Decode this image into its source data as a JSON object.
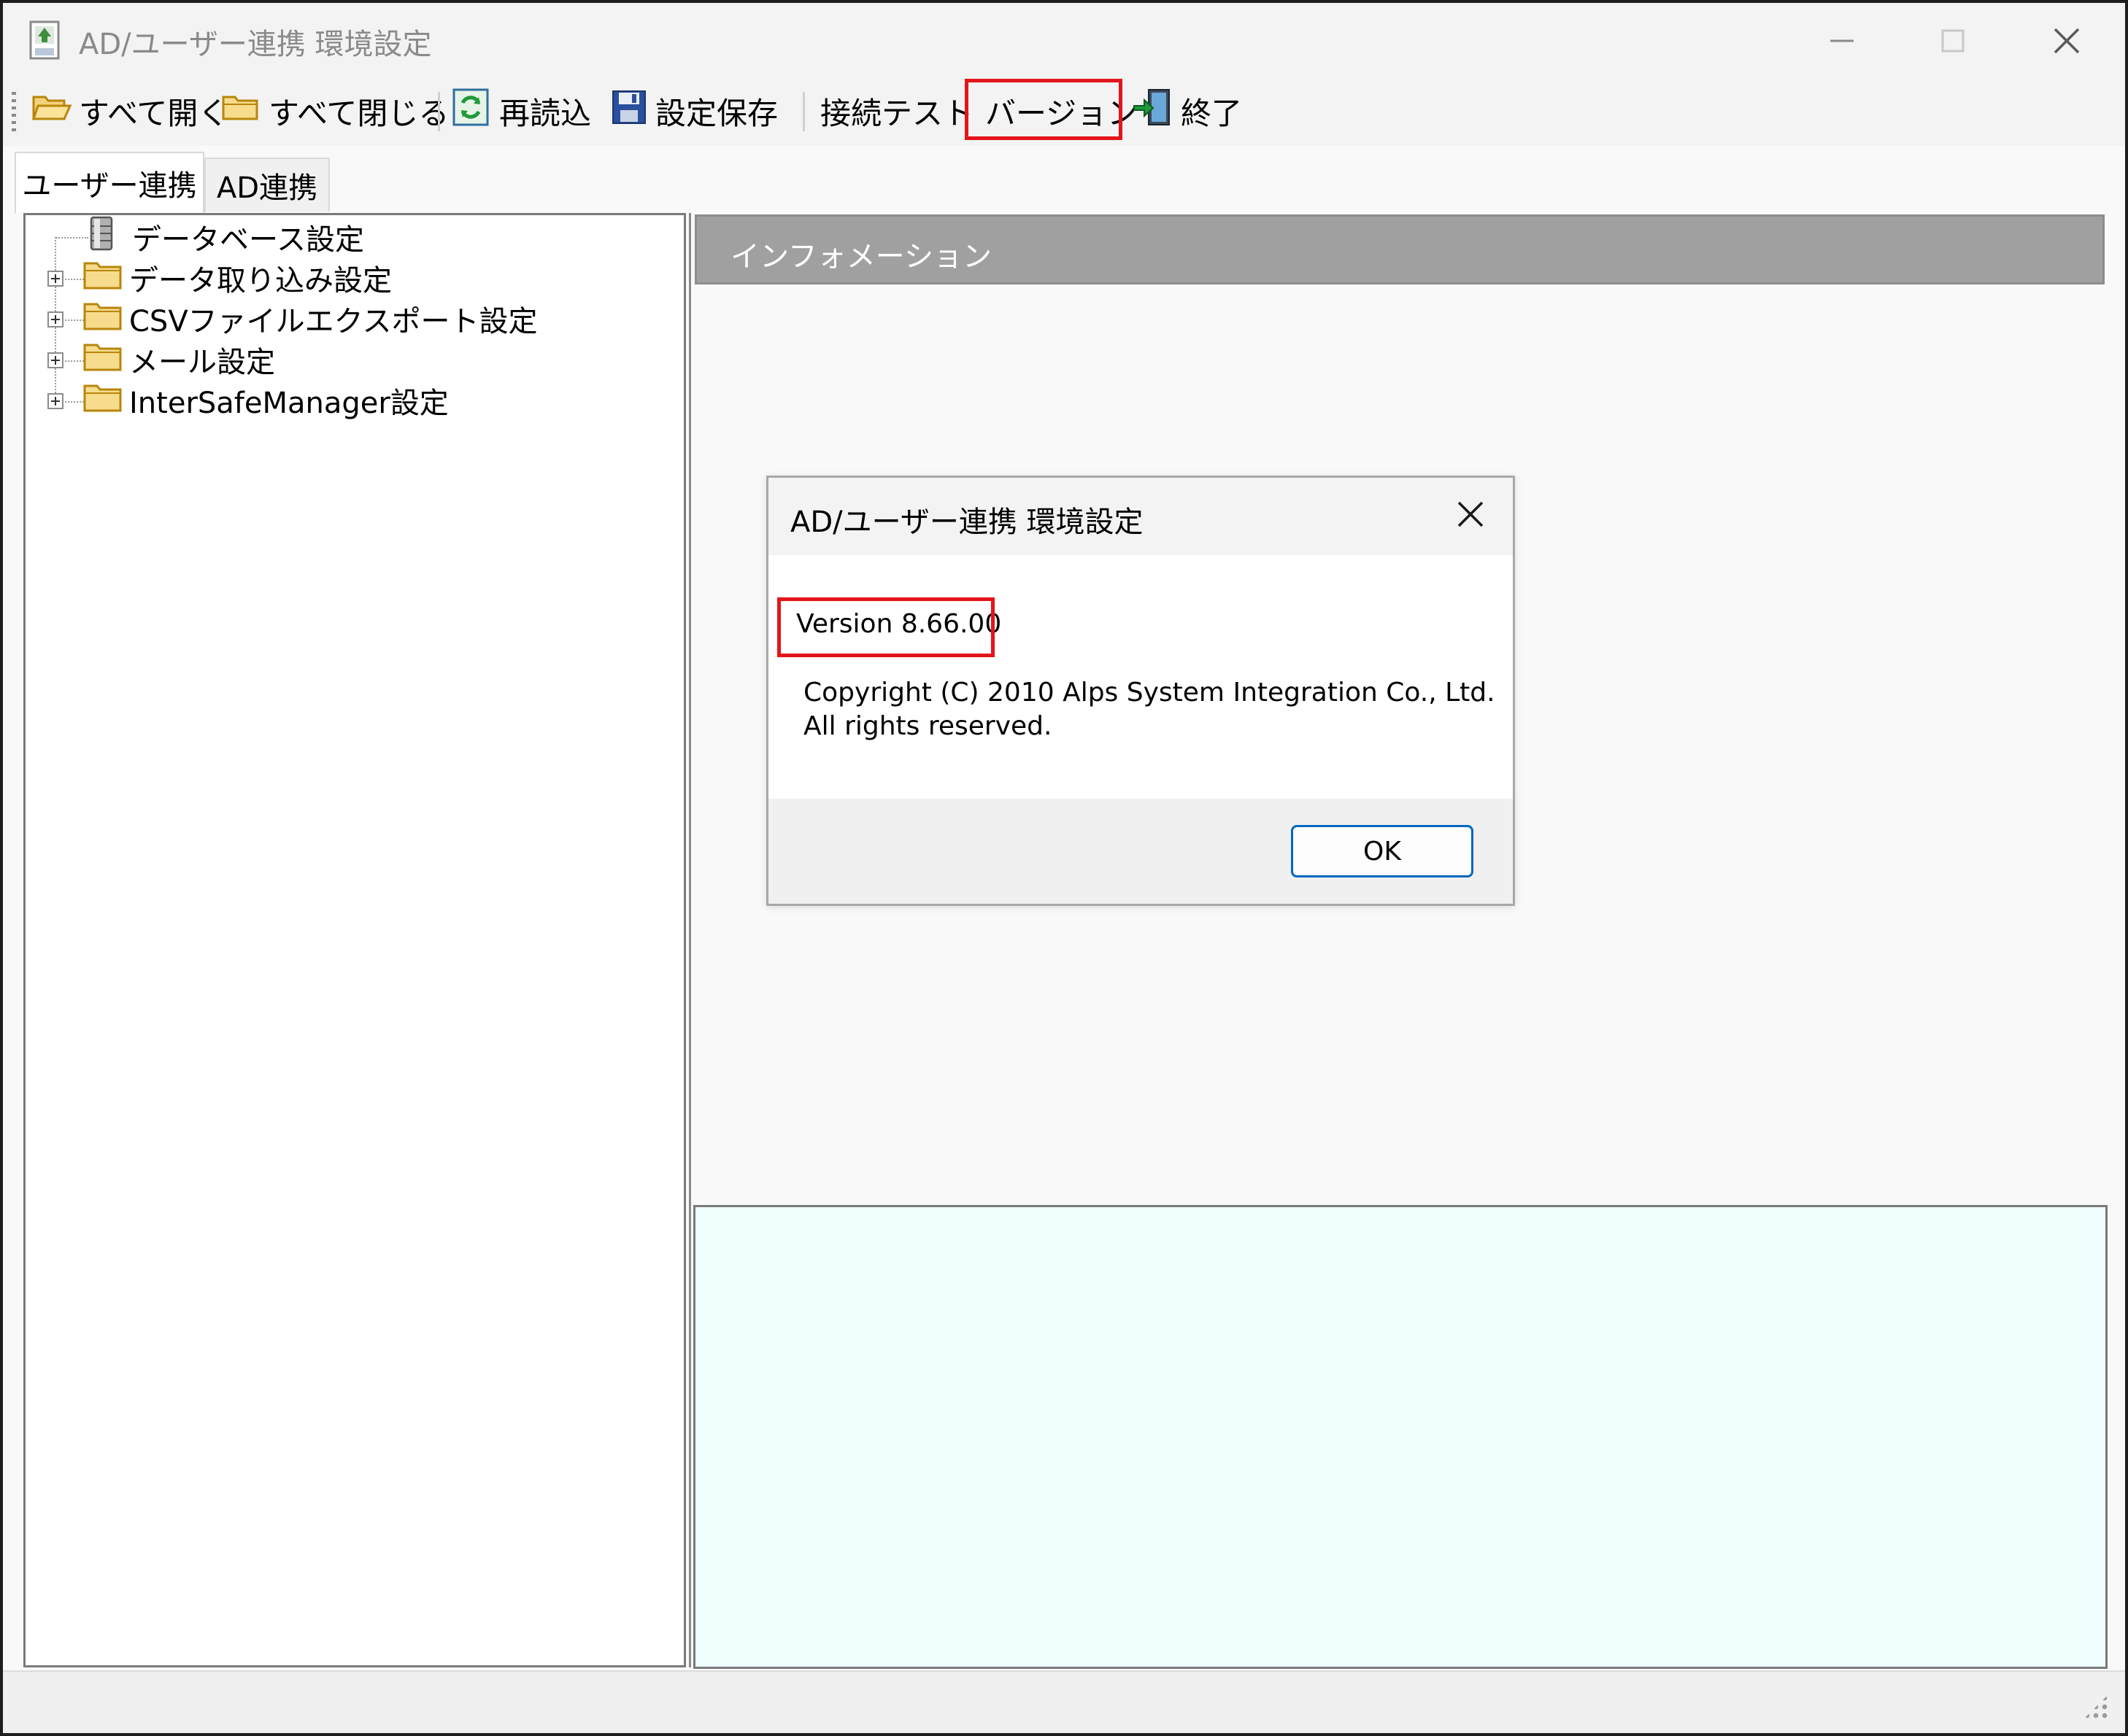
{
  "window": {
    "title": "AD/ユーザー連携 環境設定"
  },
  "toolbar": {
    "expand_all": "すべて開く",
    "collapse_all": "すべて閉じる",
    "reload": "再読込",
    "save_settings": "設定保存",
    "connection_test": "接続テスト",
    "version": "バージョン",
    "exit": "終了"
  },
  "tabs": [
    {
      "label": "ユーザー連携",
      "selected": true
    },
    {
      "label": "AD連携",
      "selected": false
    }
  ],
  "tree": {
    "items": [
      {
        "label": "データベース設定",
        "icon": "database-icon",
        "expandable": false
      },
      {
        "label": "データ取り込み設定",
        "icon": "folder-icon",
        "expandable": true
      },
      {
        "label": "CSVファイルエクスポート設定",
        "icon": "folder-icon",
        "expandable": true
      },
      {
        "label": "メール設定",
        "icon": "folder-icon",
        "expandable": true
      },
      {
        "label": "InterSafeManager設定",
        "icon": "folder-icon",
        "expandable": true
      }
    ]
  },
  "info_panel": {
    "header": "インフォメーション"
  },
  "dialog": {
    "title": "AD/ユーザー連携 環境設定",
    "version": "Version 8.66.00",
    "copyright_line1": "Copyright (C) 2010 Alps System Integration Co., Ltd.",
    "copyright_line2": "All rights reserved.",
    "ok_label": "OK"
  },
  "colors": {
    "highlight": "#e3151a",
    "info_header_bg": "#a0a0a0",
    "info_area_bg": "#f0fefe",
    "ok_border": "#0067c0"
  }
}
